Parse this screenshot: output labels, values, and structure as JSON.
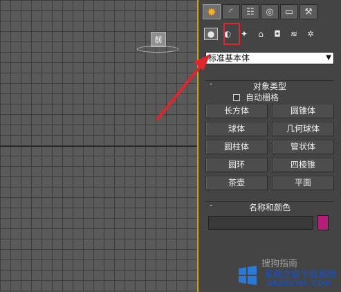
{
  "viewport": {
    "label": "前"
  },
  "command_panel": {
    "tabs": [
      {
        "icon": "create-sun-icon"
      },
      {
        "icon": "modify-curve-icon"
      },
      {
        "icon": "hierarchy-icon"
      },
      {
        "icon": "motion-icon"
      },
      {
        "icon": "display-monitor-icon"
      },
      {
        "icon": "utilities-hammer-icon"
      }
    ],
    "subtabs": [
      {
        "icon": "geometry-sphere-icon"
      },
      {
        "icon": "shapes-icon"
      },
      {
        "icon": "lights-icon"
      },
      {
        "icon": "cameras-icon"
      },
      {
        "icon": "helpers-icon"
      },
      {
        "icon": "space-warps-icon"
      },
      {
        "icon": "systems-icon"
      }
    ],
    "dropdown_value": "标准基本体",
    "object_type": {
      "title": "对象类型",
      "autogrid_label": "自动栅格",
      "buttons": [
        "长方体",
        "圆锥体",
        "球体",
        "几何球体",
        "圆柱体",
        "管状体",
        "圆环",
        "四棱锥",
        "茶壶",
        "平面"
      ]
    },
    "name_color": {
      "title": "名称和颜色",
      "name_value": "",
      "color": "#b71d78"
    }
  },
  "annotation": {
    "highlight_color": "#e0262a"
  },
  "watermarks": {
    "line1": "搜狗指南",
    "line2": "系统之家下载系统",
    "line3": "DEDECMS.COM"
  }
}
